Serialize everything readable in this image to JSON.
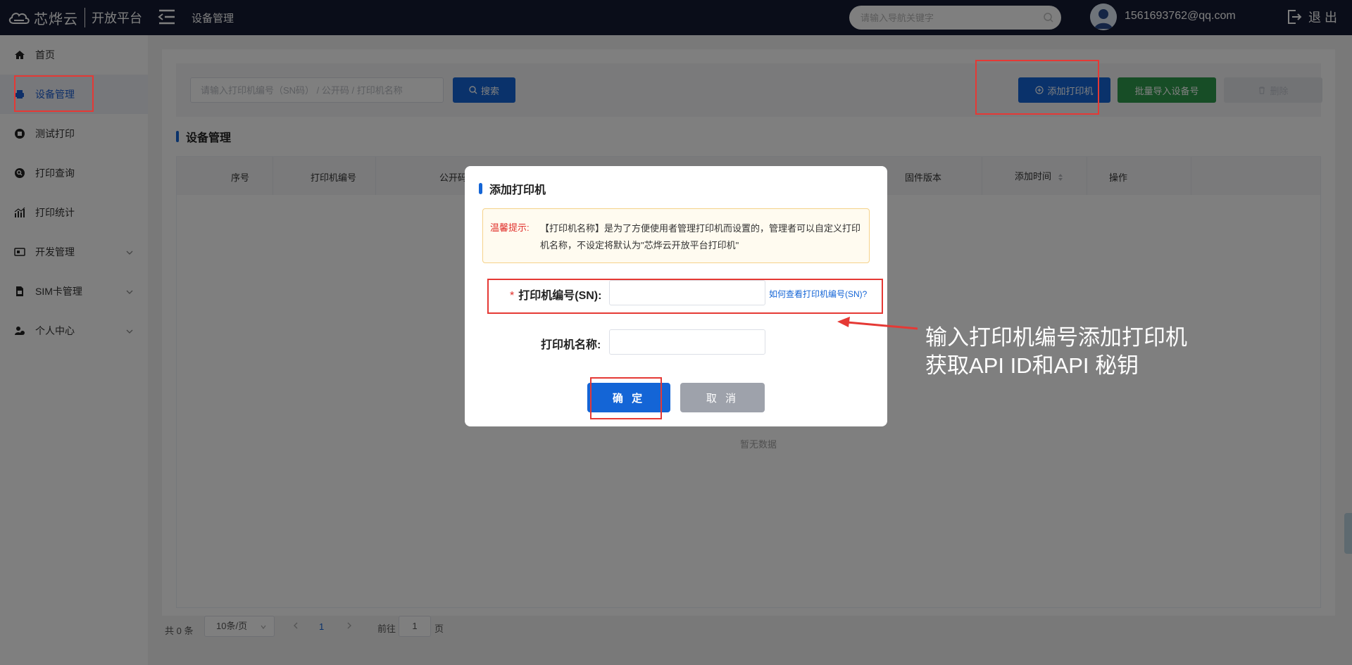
{
  "header": {
    "brand_name": "芯烨云",
    "brand_platform": "开放平台",
    "page_title": "设备管理",
    "nav_search_placeholder": "请输入导航关键字",
    "user_email": "1561693762@qq.com",
    "logout_label": "退 出"
  },
  "sidebar": {
    "items": [
      {
        "label": "首页",
        "icon": "home-icon"
      },
      {
        "label": "设备管理",
        "icon": "printer-icon",
        "active": true
      },
      {
        "label": "测试打印",
        "icon": "print-test-icon"
      },
      {
        "label": "打印查询",
        "icon": "search-icon"
      },
      {
        "label": "打印统计",
        "icon": "stats-icon"
      },
      {
        "label": "开发管理",
        "icon": "dev-icon",
        "expandable": true
      },
      {
        "label": "SIM卡管理",
        "icon": "sim-icon",
        "expandable": true
      },
      {
        "label": "个人中心",
        "icon": "user-icon",
        "expandable": true
      }
    ]
  },
  "toolbar": {
    "search_placeholder": "请输入打印机编号（SN码） / 公开码 / 打印机名称",
    "search_label": "搜索",
    "add_label": "添加打印机",
    "import_label": "批量导入设备号",
    "delete_label": "删除"
  },
  "section_title": "设备管理",
  "table": {
    "columns": [
      "序号",
      "打印机编号",
      "公开码",
      "固件版本",
      "添加时间",
      "操作"
    ],
    "empty_text": "暂无数据"
  },
  "pager": {
    "total": "共 0 条",
    "page_size": "10条/页",
    "current_page": "1",
    "goto_label": "前往",
    "goto_value": "1",
    "goto_unit": "页"
  },
  "modal": {
    "title": "添加打印机",
    "tip_label": "温馨提示:",
    "tip_text": "【打印机名称】是为了方便使用者管理打印机而设置的，管理者可以自定义打印机名称，不设定将默认为\"芯烨云开放平台打印机\"",
    "sn_label": "打印机编号(SN):",
    "sn_help": "如何查看打印机编号(SN)?",
    "name_label": "打印机名称:",
    "ok_label": "确 定",
    "cancel_label": "取 消"
  },
  "annotation": {
    "line1": "输入打印机编号添加打印机",
    "line2": "获取API ID和API 秘钥"
  },
  "colors": {
    "topbar": "#141b33",
    "primary": "#1465d6",
    "success": "#2e9b4d",
    "highlight": "#e53935"
  }
}
